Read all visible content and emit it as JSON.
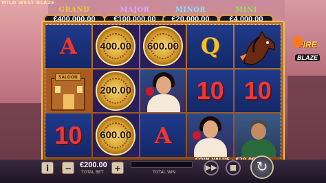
{
  "game_title": "WILD WEST BLAZE",
  "jackpots": [
    {
      "label": "GRAND",
      "value": "€400,000.00"
    },
    {
      "label": "MAJOR",
      "value": "€100,000.00"
    },
    {
      "label": "MINOR",
      "value": "€20,000.00"
    },
    {
      "label": "MINI",
      "value": "€4,000.00"
    }
  ],
  "reels": {
    "row1": [
      "A",
      "400.00",
      "600.00",
      "Q",
      "horse"
    ],
    "row2": [
      "saloon",
      "200.00",
      "woman",
      "10",
      "10"
    ],
    "row3": [
      "10",
      "600.00",
      "A",
      "woman",
      "man"
    ]
  },
  "symbols": {
    "saloon_sign": "SALOON"
  },
  "logo": {
    "line1": "FIRE",
    "line2": "BLAZE"
  },
  "coin_value": "COIN VALUE - €20.00",
  "bottom_bar": {
    "info_icon": "i",
    "minus_icon": "−",
    "plus_icon": "+",
    "bet_value": "€200.00",
    "bet_label": "TOTAL BET",
    "win_label": "TOTAL WIN",
    "autoplay_icon": "▶▶",
    "stop_icon": "■",
    "spin_icon": "↻"
  },
  "colors": {
    "reel_bg": "#1f3a8a",
    "coin_bg": "#2a1e5a",
    "frame": "#c17a2c",
    "number_red": "#e63a3a",
    "letter_gold": "#f4c030"
  }
}
